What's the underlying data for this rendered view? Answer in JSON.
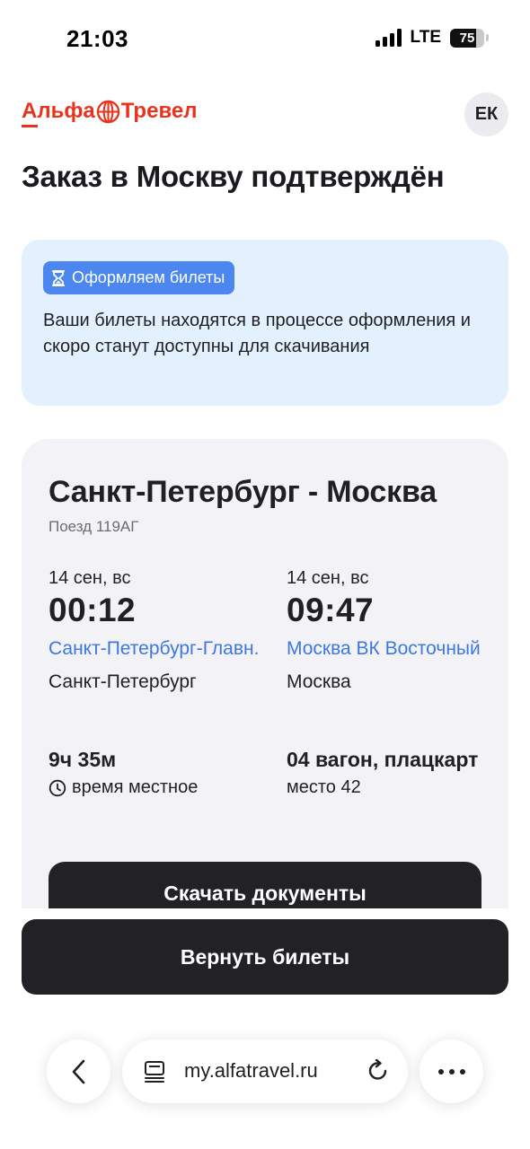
{
  "status_bar": {
    "time": "21:03",
    "network": "LTE",
    "battery": "75",
    "battery_level": 0.75
  },
  "header": {
    "logo_left": "Альфа",
    "logo_right": "Тревел",
    "avatar_initials": "ЕК"
  },
  "page_title": "Заказ в Москву подтверждён",
  "banner": {
    "badge": "Оформляем билеты",
    "text": "Ваши билеты находятся в процессе оформления и скоро станут доступны для скачивания"
  },
  "ticket": {
    "route": "Санкт-Петербург - Москва",
    "train": "Поезд 119АГ",
    "departure": {
      "date": "14 сен, вс",
      "time": "00:12",
      "station": "Санкт-Петербург-Главн.",
      "city": "Санкт-Петербург"
    },
    "arrival": {
      "date": "14 сен, вс",
      "time": "09:47",
      "station": "Москва ВК Восточный",
      "city": "Москва"
    },
    "duration": "9ч 35м",
    "time_note": "время местное",
    "car": "04 вагон, плацкарт",
    "seat": "место 42",
    "download_label": "Скачать документы"
  },
  "return_label": "Вернуть билеты",
  "browser": {
    "url": "my.alfatravel.ru"
  },
  "colors": {
    "brand": "#e8341e",
    "accent": "#4c87f0",
    "link": "#3d78dd",
    "banner_bg": "#e3f0fd",
    "button": "#222226"
  }
}
